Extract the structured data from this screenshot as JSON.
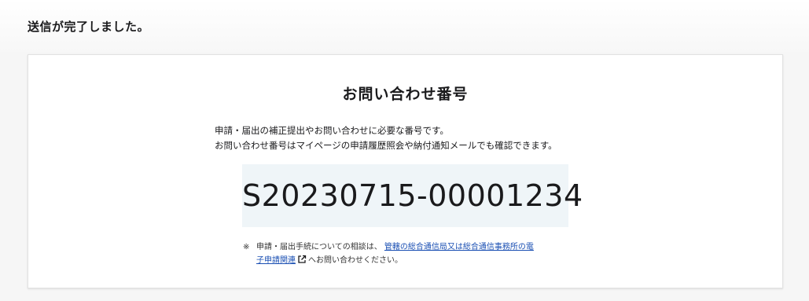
{
  "status": {
    "message": "送信が完了しました。"
  },
  "card": {
    "title": "お問い合わせ番号",
    "description_lines": [
      "申請・届出の補正提出やお問い合わせに必要な番号です。",
      "お問い合わせ番号はマイページの申請履歴照会や納付通知メールでも確認できます。"
    ],
    "inquiry_number": "S20230715-00001234"
  },
  "note": {
    "mark": "※",
    "prefix": "申請・届出手続についての相談は、",
    "link_text_1": "管轄の総合通信局又は総合通信事務所の電",
    "link_text_2": "子申請関連",
    "suffix": "へお問い合わせください。",
    "link_icon": "external-link-icon"
  },
  "colors": {
    "link": "#1a4fb3",
    "number_background": "#eff5f8"
  }
}
